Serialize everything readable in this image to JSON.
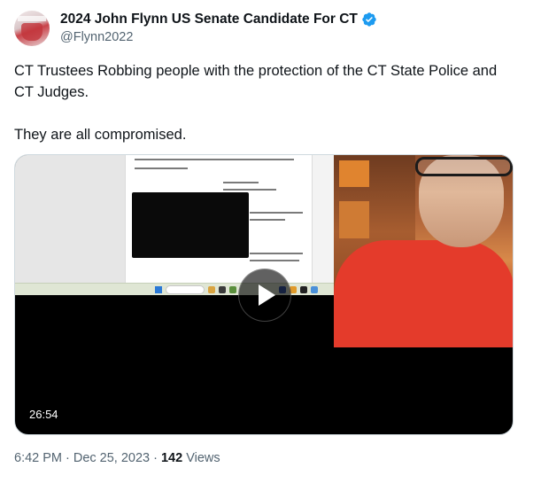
{
  "author": {
    "display_name": "2024 John Flynn US Senate Candidate For CT",
    "handle": "@Flynn2022",
    "verified": true,
    "verified_color": "#1d9bf0",
    "avatar_icon": "profile-photo"
  },
  "tweet": {
    "paragraphs": [
      "CT Trustees Robbing people with the protection of the CT State Police and CT Judges.",
      "They are all compromised."
    ]
  },
  "media": {
    "type": "video",
    "duration": "26:54",
    "play_icon": "play-icon"
  },
  "meta": {
    "time": "6:42 PM",
    "separator": "·",
    "date": "Dec 25, 2023",
    "views_count": "142",
    "views_label": "Views"
  }
}
